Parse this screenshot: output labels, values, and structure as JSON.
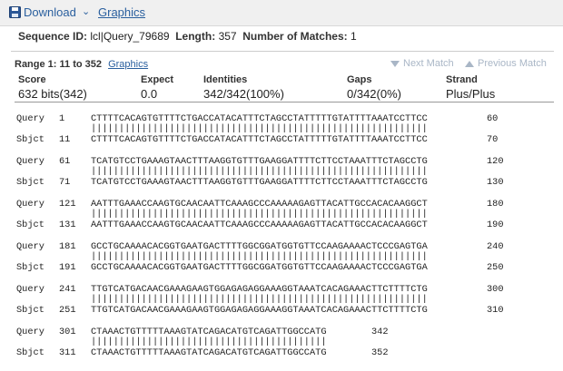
{
  "toolbar": {
    "download_label": "Download",
    "caret": "⌄",
    "graphics_label": "Graphics"
  },
  "seqinfo": {
    "id_label": "Sequence ID:",
    "id_value": "lcl|Query_79689",
    "length_label": "Length:",
    "length_value": "357",
    "matches_label": "Number of Matches:",
    "matches_value": "1"
  },
  "range": {
    "label": "Range 1: 11 to 352",
    "graphics_link": "Graphics",
    "next_match": "Next Match",
    "previous_match": "Previous Match"
  },
  "score": {
    "headers": [
      "Score",
      "Expect",
      "Identities",
      "Gaps",
      "Strand"
    ],
    "values": [
      "632 bits(342)",
      "0.0",
      "342/342(100%)",
      "0/342(0%)",
      "Plus/Plus"
    ]
  },
  "alignment": {
    "query_label": "Query",
    "subject_label": "Sbjct",
    "blocks": [
      {
        "q_start": "1",
        "q_seq": "CTTTTCACAGTGTTTTCTGACCATACATTTCTAGCCTATTTTTGTATTTTAAATCCTTCC",
        "q_end": "60",
        "match": "||||||||||||||||||||||||||||||||||||||||||||||||||||||||||||",
        "s_start": "11",
        "s_seq": "CTTTTCACAGTGTTTTCTGACCATACATTTCTAGCCTATTTTTGTATTTTAAATCCTTCC",
        "s_end": "70"
      },
      {
        "q_start": "61",
        "q_seq": "TCATGTCCTGAAAGTAACTTTAAGGTGTTTGAAGGATTTTCTTCCTAAATTTCTAGCCTG",
        "q_end": "120",
        "match": "||||||||||||||||||||||||||||||||||||||||||||||||||||||||||||",
        "s_start": "71",
        "s_seq": "TCATGTCCTGAAAGTAACTTTAAGGTGTTTGAAGGATTTTCTTCCTAAATTTCTAGCCTG",
        "s_end": "130"
      },
      {
        "q_start": "121",
        "q_seq": "AATTTGAAACCAAGTGCAACAATTCAAAGCCCAAAAAGAGTTACATTGCCACACAAGGCT",
        "q_end": "180",
        "match": "||||||||||||||||||||||||||||||||||||||||||||||||||||||||||||",
        "s_start": "131",
        "s_seq": "AATTTGAAACCAAGTGCAACAATTCAAAGCCCAAAAAGAGTTACATTGCCACACAAGGCT",
        "s_end": "190"
      },
      {
        "q_start": "181",
        "q_seq": "GCCTGCAAAACACGGTGAATGACTTTTGGCGGATGGTGTTCCAAGAAAACTCCCGAGTGA",
        "q_end": "240",
        "match": "||||||||||||||||||||||||||||||||||||||||||||||||||||||||||||",
        "s_start": "191",
        "s_seq": "GCCTGCAAAACACGGTGAATGACTTTTGGCGGATGGTGTTCCAAGAAAACTCCCGAGTGA",
        "s_end": "250"
      },
      {
        "q_start": "241",
        "q_seq": "TTGTCATGACAACGAAAGAAGTGGAGAGAGGAAAGGTAAATCACAGAAACTTCTTTTCTG",
        "q_end": "300",
        "match": "||||||||||||||||||||||||||||||||||||||||||||||||||||||||||||",
        "s_start": "251",
        "s_seq": "TTGTCATGACAACGAAAGAAGTGGAGAGAGGAAAGGTAAATCACAGAAACTTCTTTTCTG",
        "s_end": "310"
      },
      {
        "q_start": "301",
        "q_seq": "CTAAACTGTTTTTAAAGTATCAGACATGTCAGATTGGCCATG",
        "q_end": "342",
        "match": "||||||||||||||||||||||||||||||||||||||||||",
        "s_start": "311",
        "s_seq": "CTAAACTGTTTTTAAAGTATCAGACATGTCAGATTGGCCATG",
        "s_end": "352"
      }
    ]
  }
}
